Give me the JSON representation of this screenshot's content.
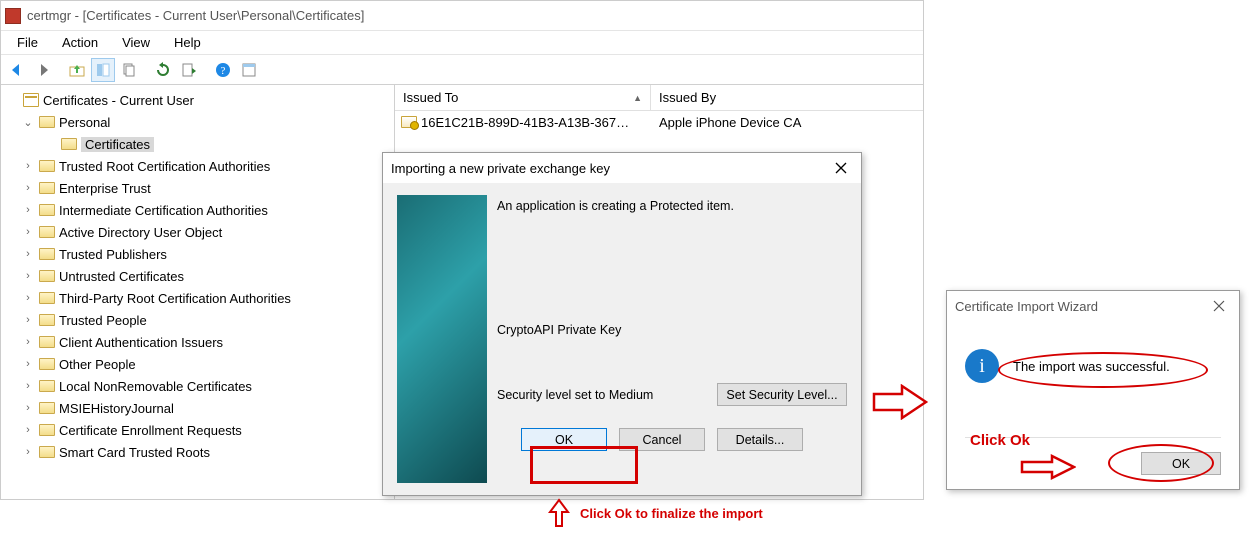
{
  "window": {
    "title": "certmgr - [Certificates - Current User\\Personal\\Certificates]",
    "menu": {
      "file": "File",
      "action": "Action",
      "view": "View",
      "help": "Help"
    }
  },
  "tree": {
    "root": "Certificates - Current User",
    "personal": "Personal",
    "certificates": "Certificates",
    "items": [
      "Trusted Root Certification Authorities",
      "Enterprise Trust",
      "Intermediate Certification Authorities",
      "Active Directory User Object",
      "Trusted Publishers",
      "Untrusted Certificates",
      "Third-Party Root Certification Authorities",
      "Trusted People",
      "Client Authentication Issuers",
      "Other People",
      "Local NonRemovable Certificates",
      "MSIEHistoryJournal",
      "Certificate Enrollment Requests",
      "Smart Card Trusted Roots"
    ]
  },
  "list": {
    "col1": "Issued To",
    "col2": "Issued By",
    "row1_issued_to": "16E1C21B-899D-41B3-A13B-367…",
    "row1_issued_by": "Apple iPhone Device CA"
  },
  "dialog_import": {
    "title": "Importing a new private exchange key",
    "msg": "An application is creating a Protected item.",
    "keyname": "CryptoAPI Private Key",
    "sec_label": "Security level set to Medium",
    "set_level": "Set Security Level...",
    "ok": "OK",
    "cancel": "Cancel",
    "details": "Details..."
  },
  "dialog_wizard": {
    "title": "Certificate Import Wizard",
    "msg": "The import was successful.",
    "ok": "OK"
  },
  "annotations": {
    "finalize": "Click Ok to finalize the import",
    "click_ok": "Click Ok"
  }
}
